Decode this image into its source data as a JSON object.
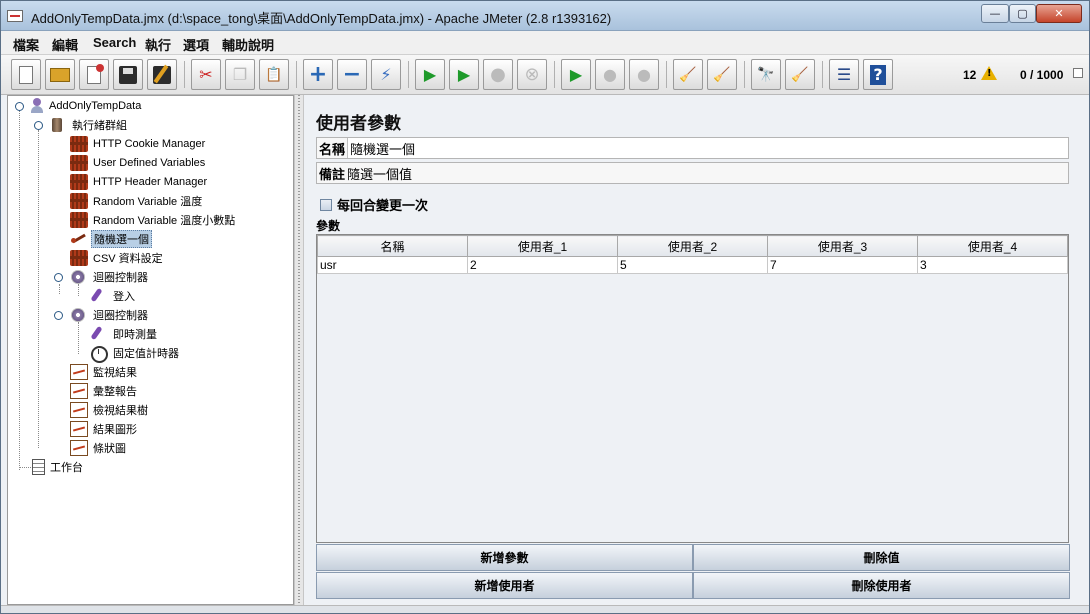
{
  "window": {
    "title": "AddOnlyTempData.jmx (d:\\space_tong\\桌面\\AddOnlyTempData.jmx) - Apache JMeter (2.8 r1393162)",
    "min_glyph": "—",
    "max_glyph": "▢",
    "close_glyph": "✕"
  },
  "menu": [
    "檔案",
    "編輯",
    "Search",
    "執行",
    "選項",
    "輔助說明"
  ],
  "toolbar": {
    "icons": [
      "new-icon",
      "open-icon",
      "close-file-icon",
      "save-icon",
      "save-as-icon",
      "cut-icon",
      "copy-icon",
      "paste-icon",
      "expand-icon",
      "collapse-icon",
      "toggle-icon",
      "start-icon",
      "start-no-pause-icon",
      "stop-icon",
      "shutdown-icon",
      "remote-start-icon",
      "remote-stop-icon",
      "remote-shutdown-icon",
      "clear-icon",
      "clear-all-icon",
      "search-icon",
      "reset-search-icon",
      "function-helper-icon",
      "help-icon"
    ],
    "glyphs": {
      "new": "",
      "open": "",
      "close_file": "",
      "save": "",
      "save_as": "",
      "cut": "✂",
      "copy": "❐",
      "paste": "📋",
      "expand": "+",
      "collapse": "−",
      "toggle": "⚡",
      "start": "▶",
      "start_no_pause": "▶",
      "stop": "●",
      "shutdown": "⊗",
      "remote_start": "▶",
      "remote_stop": "●",
      "remote_shutdown": "●",
      "clear": "🧹",
      "clear_all": "🧹",
      "search": "🔭",
      "reset_search": "🧹",
      "function_helper": "☰",
      "help": "?"
    },
    "error_count": "12",
    "thread_status": "0 / 1000"
  },
  "tree": {
    "test_plan": "AddOnlyTempData",
    "thread_group": "執行緒群組",
    "items": [
      {
        "label": "HTTP Cookie Manager",
        "icon": "config-icon"
      },
      {
        "label": "User Defined Variables",
        "icon": "config-icon"
      },
      {
        "label": "HTTP Header Manager",
        "icon": "config-icon"
      },
      {
        "label": "Random Variable 溫度",
        "icon": "config-icon"
      },
      {
        "label": "Random Variable 溫度小數點",
        "icon": "config-icon"
      },
      {
        "label": "隨機選一個",
        "icon": "random-icon",
        "selected": true
      },
      {
        "label": "CSV 資料設定",
        "icon": "config-icon"
      }
    ],
    "loop1": {
      "label": "迴圈控制器",
      "child": "登入"
    },
    "loop2": {
      "label": "迴圈控制器",
      "children": [
        "即時測量",
        "固定值計時器"
      ]
    },
    "listeners": [
      "監視結果",
      "彙整報告",
      "檢視結果樹",
      "結果圖形",
      "條狀圖"
    ],
    "workbench": "工作台"
  },
  "panel": {
    "title": "使用者參數",
    "name_label": "名稱",
    "name_value": "隨機選一個",
    "comment_label": "備註",
    "comment_value": "隨選一個值",
    "per_iteration_label": "每回合變更一次",
    "params_label": "參數",
    "table": {
      "headers": [
        "名稱",
        "使用者_1",
        "使用者_2",
        "使用者_3",
        "使用者_4"
      ],
      "rows": [
        [
          "usr",
          "2",
          "5",
          "7",
          "3"
        ]
      ]
    },
    "buttons": {
      "add_param": "新增參數",
      "delete_value": "刪除值",
      "add_user": "新增使用者",
      "delete_user": "刪除使用者"
    }
  },
  "colors": {
    "titlebar": "#b8cde3",
    "selection": "#b8cfe5",
    "close_button": "#c5442b",
    "warning": "#e8b000"
  }
}
